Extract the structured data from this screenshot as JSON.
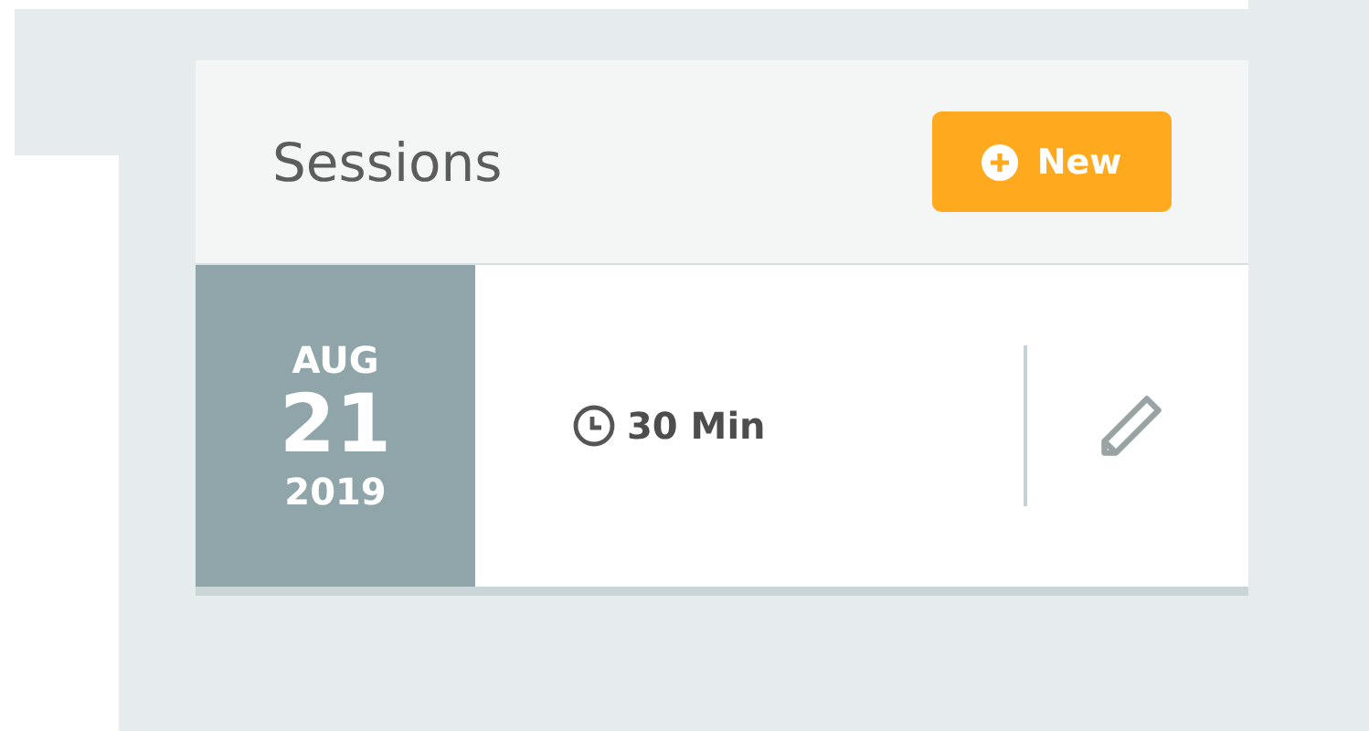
{
  "panel": {
    "title": "Sessions",
    "new_button": "New"
  },
  "sessions": [
    {
      "month": "AUG",
      "day": "21",
      "year": "2019",
      "duration": "30 Min"
    }
  ]
}
